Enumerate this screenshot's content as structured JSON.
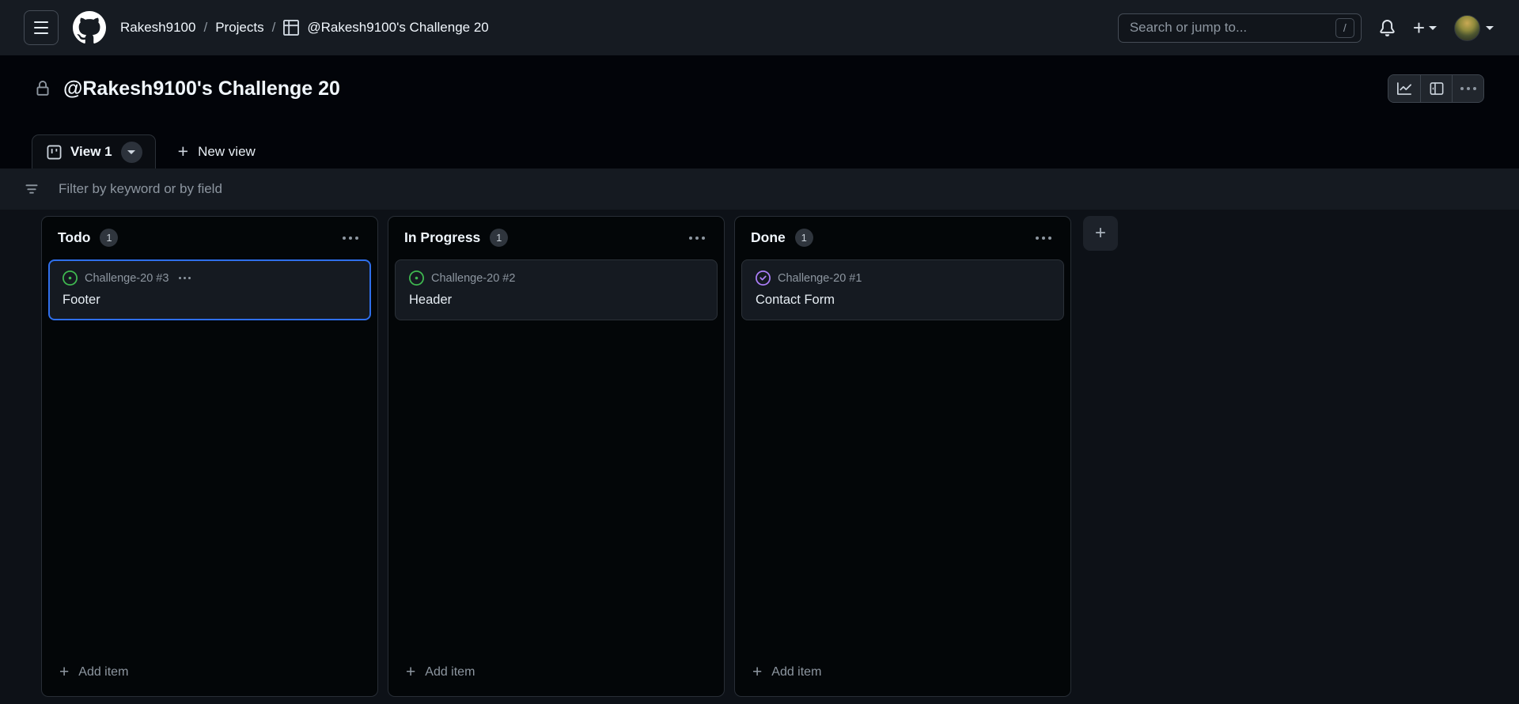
{
  "colors": {
    "accent_blue": "#2f6feb",
    "issue_open_green": "#3fb950",
    "issue_done_purple": "#ab7df8",
    "header_bg": "#161b22",
    "page_bg": "#020409",
    "filter_bar_bg": "#151a21",
    "board_bg": "#0d1117",
    "column_bg": "#030608",
    "card_bg": "#151a21",
    "border": "#2b3138",
    "text_primary": "#f0f6fc",
    "text_secondary": "#8d96a0"
  },
  "header": {
    "breadcrumb": {
      "user": "Rakesh9100",
      "separator1": "/",
      "section": "Projects",
      "separator2": "/",
      "project": "@Rakesh9100's Challenge 20"
    },
    "search": {
      "placeholder": "Search or jump to...",
      "shortcut_key": "/"
    }
  },
  "page": {
    "title": "@Rakesh9100's Challenge 20"
  },
  "views": {
    "active_tab": "View 1",
    "new_view_plus": "+",
    "new_view": "New view"
  },
  "filter": {
    "placeholder": "Filter by keyword or by field"
  },
  "board": {
    "add_item_label": "Add item",
    "add_item_plus": "+",
    "add_column_plus": "+",
    "columns": [
      {
        "name": "Todo",
        "count": "1",
        "card": {
          "ref": "Challenge-20 #3",
          "title": "Footer",
          "status": "open"
        }
      },
      {
        "name": "In Progress",
        "count": "1",
        "card": {
          "ref": "Challenge-20 #2",
          "title": "Header",
          "status": "open"
        }
      },
      {
        "name": "Done",
        "count": "1",
        "card": {
          "ref": "Challenge-20 #1",
          "title": "Contact Form",
          "status": "closed"
        }
      }
    ]
  }
}
